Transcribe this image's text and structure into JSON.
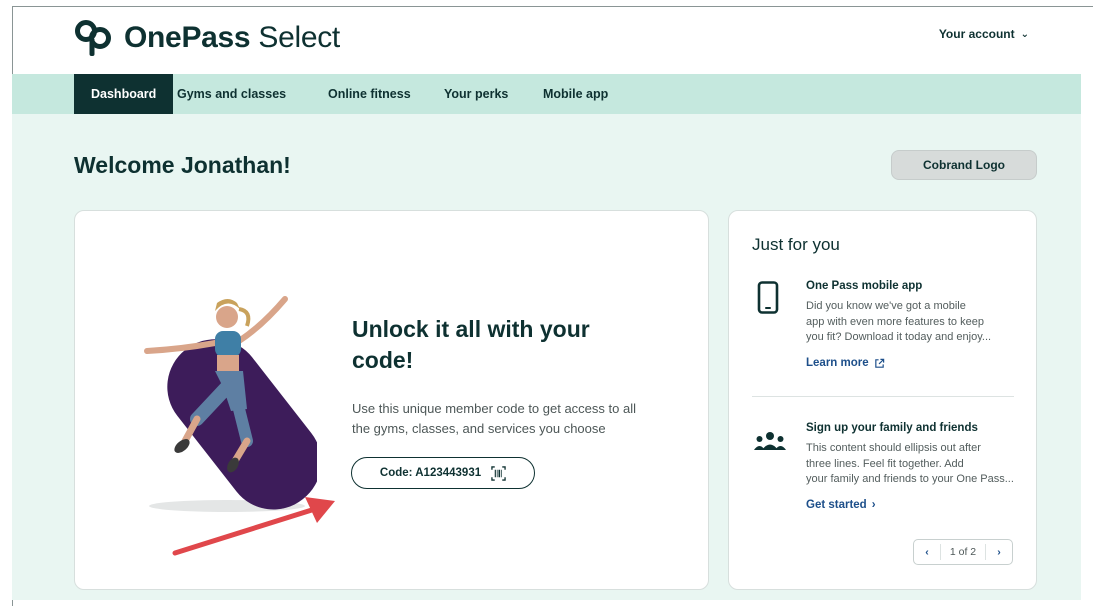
{
  "brand": {
    "name_bold": "One",
    "name_bold2": "Pass",
    "name_light": "Select",
    "logo_icon": "onepass-logo-icon"
  },
  "header": {
    "account_label": "Your account",
    "account_chevron": "⌄"
  },
  "nav": {
    "items": [
      {
        "label": "Dashboard",
        "active": true
      },
      {
        "label": "Gyms and classes"
      },
      {
        "label": "Online fitness"
      },
      {
        "label": "Your perks"
      },
      {
        "label": "Mobile app"
      }
    ]
  },
  "main": {
    "welcome": "Welcome Jonathan!",
    "cobrand_label": "Cobrand Logo",
    "unlock_card": {
      "title": "Unlock it all with your code!",
      "description": "Use this unique member code to get access to all the gyms, classes, and services you choose",
      "code_label": "Code: A123443931",
      "code_icon": "barcode-scan-icon"
    }
  },
  "sidebar": {
    "title": "Just for you",
    "promos": [
      {
        "icon": "smartphone-icon",
        "title": "One Pass mobile app",
        "body_lines": [
          "Did you know we've got a mobile",
          "app with even more features to keep",
          "you fit? Download it today and enjoy..."
        ],
        "link": "Learn more",
        "link_icon": "external-link-icon"
      },
      {
        "icon": "group-people-icon",
        "title": "Sign up your family and friends",
        "body_lines": [
          "This content should ellipsis out after",
          "three lines. Feel fit together. Add",
          "your family and friends to your One Pass..."
        ],
        "link": "Get started",
        "link_icon": "chevron-right-icon"
      }
    ],
    "pager": {
      "label": "1 of 2",
      "prev": "‹",
      "next": "›"
    }
  },
  "colors": {
    "brand_dark": "#0e3131",
    "nav_bg": "#c5e8de",
    "page_bg": "#e9f6f2",
    "link": "#1d4f8a",
    "hero_blob": "#3d1c5a",
    "annotation_arrow": "#e0474b"
  }
}
